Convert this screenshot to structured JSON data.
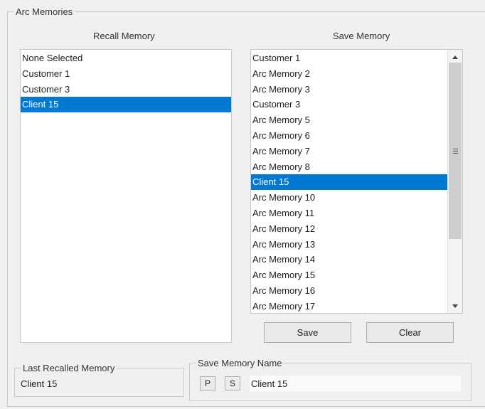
{
  "arc_memories": {
    "title": "Arc Memories",
    "recall": {
      "header": "Recall Memory",
      "items": [
        "None Selected",
        "Customer 1",
        "Customer 3",
        "Client 15"
      ],
      "selected_index": 3
    },
    "save": {
      "header": "Save Memory",
      "items": [
        "Customer 1",
        "Arc Memory 2",
        "Arc Memory 3",
        "Customer 3",
        "Arc Memory 5",
        "Arc Memory 6",
        "Arc Memory 7",
        "Arc Memory 8",
        "Client 15",
        "Arc Memory 10",
        "Arc Memory 11",
        "Arc Memory 12",
        "Arc Memory 13",
        "Arc Memory 14",
        "Arc Memory 15",
        "Arc Memory 16",
        "Arc Memory 17"
      ],
      "selected_index": 8,
      "save_label": "Save",
      "clear_label": "Clear"
    }
  },
  "last_recalled": {
    "title": "Last Recalled Memory",
    "value": "Client 15"
  },
  "save_memory_name": {
    "title": "Save Memory Name",
    "p_label": "P",
    "s_label": "S",
    "value": "Client 15"
  },
  "colors": {
    "selection": "#0078d4",
    "background": "#f0f0f0"
  }
}
